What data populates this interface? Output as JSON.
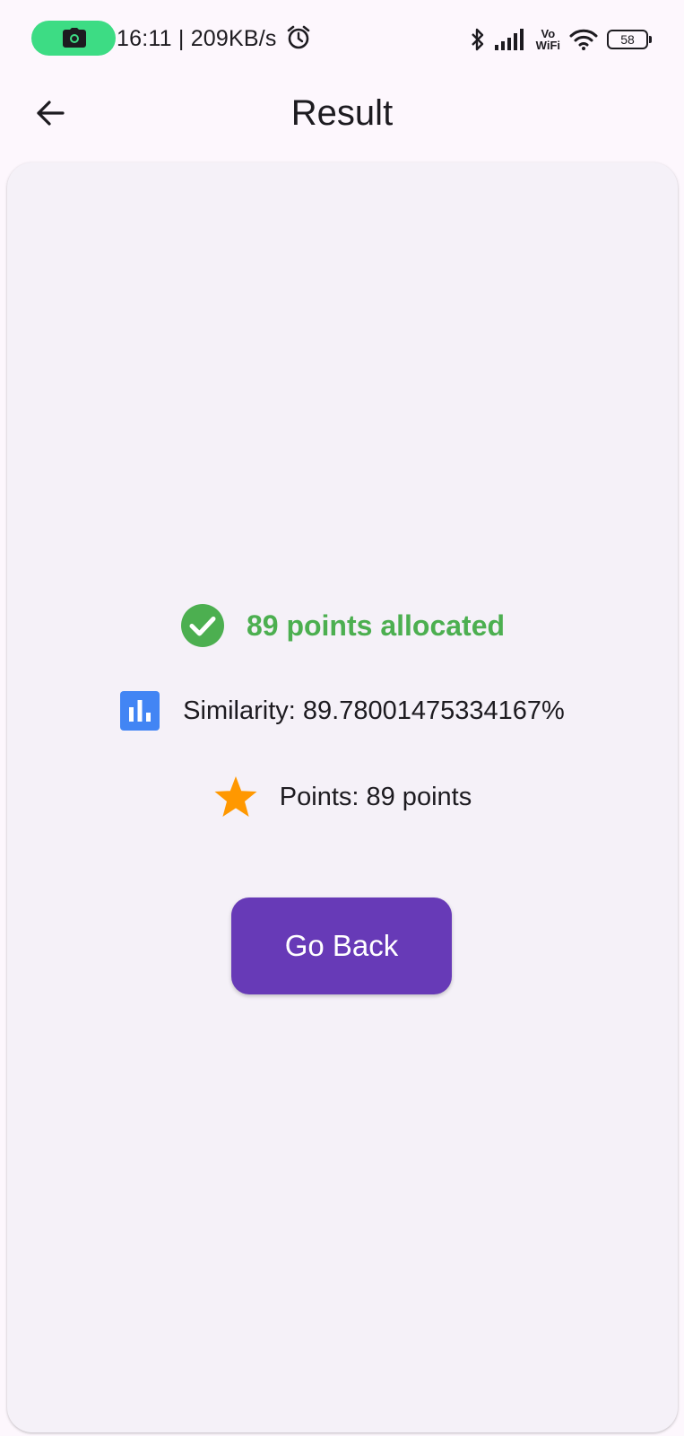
{
  "status_bar": {
    "time_speed": "16:11 | 209KB/s",
    "vowifi_top": "Vo",
    "vowifi_bottom": "WiFi",
    "battery_level": "58",
    "icons": [
      "camera-icon",
      "alarm-icon",
      "bluetooth-icon",
      "signal-icon",
      "wifi-icon",
      "battery-icon"
    ],
    "recording_pill_color": "#3ddc84"
  },
  "app_bar": {
    "title": "Result",
    "back_icon": "arrow-back-icon"
  },
  "result": {
    "allocated_text": "89 points allocated",
    "allocated_icon": "check-circle-icon",
    "allocated_color": "#4caf50",
    "similarity_text": "Similarity: 89.78001475334167%",
    "similarity_icon": "bar-chart-icon",
    "similarity_icon_color": "#4285f4",
    "points_text": "Points: 89 points",
    "points_icon": "star-icon",
    "points_icon_color": "#ff9800"
  },
  "actions": {
    "go_back_label": "Go Back",
    "go_back_color": "#673ab7"
  }
}
